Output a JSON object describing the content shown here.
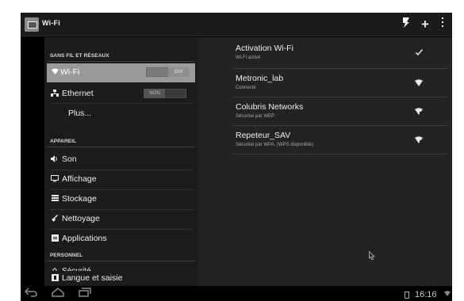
{
  "actionbar": {
    "title": "Wi-Fi",
    "icons": [
      "wps-icon",
      "add-icon",
      "overflow-menu-icon"
    ]
  },
  "sidebar": {
    "sections": [
      {
        "heading": "SANS FIL ET RÉSEAUX"
      },
      {
        "heading": "APPAREIL"
      },
      {
        "heading": "PERSONNEL"
      }
    ],
    "items": [
      {
        "label": "Wi-Fi",
        "icon": "wifi-icon",
        "toggle": "OUI",
        "active": true
      },
      {
        "label": "Ethernet",
        "icon": "ethernet-icon",
        "toggle": "NON"
      },
      {
        "label": "Plus..."
      },
      {
        "label": "Son",
        "icon": "speaker-icon"
      },
      {
        "label": "Affichage",
        "icon": "display-icon"
      },
      {
        "label": "Stockage",
        "icon": "storage-icon"
      },
      {
        "label": "Nettoyage",
        "icon": "broom-icon"
      },
      {
        "label": "Applications",
        "icon": "apps-icon"
      },
      {
        "label": "Sécurité",
        "icon": "lock-icon"
      },
      {
        "label": "Langue et saisie",
        "icon": "keyboard-icon"
      }
    ]
  },
  "wifi_list": [
    {
      "name": "Activation Wi-Fi",
      "subtitle": "Wi-Fi activé",
      "icon": "check-icon"
    },
    {
      "name": "Metronic_lab",
      "subtitle": "Connecté",
      "icon": "wifi-signal-icon"
    },
    {
      "name": "Colubris Networks",
      "subtitle": "Sécurisé par WEP",
      "icon": "wifi-secure-icon"
    },
    {
      "name": "Repeteur_SAV",
      "subtitle": "Sécurisé par WPA. (WPS disponible)",
      "icon": "wifi-secure-icon"
    }
  ],
  "statusbar": {
    "time": "16:16",
    "icons": [
      "back-icon",
      "home-icon",
      "recents-icon",
      "battery-icon",
      "wifi-status-icon"
    ]
  },
  "colors": {
    "background": "#000000",
    "left_pane": "#1c1c1c",
    "right_pane": "#232323",
    "active_item": "#9a9a9a"
  }
}
